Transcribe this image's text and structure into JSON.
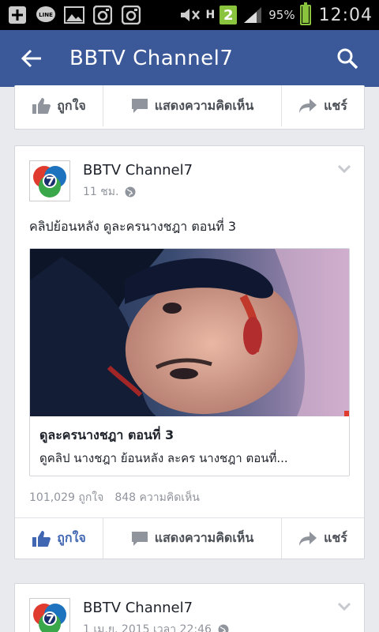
{
  "status_bar": {
    "network": "H",
    "sim_badge": "2",
    "battery_percent_label": "95%",
    "battery_level": 0.95,
    "time": "12:04"
  },
  "app_bar": {
    "title": "BBTV Channel7"
  },
  "top_actions": {
    "like": "ถูกใจ",
    "comment": "แสดงความคิดเห็น",
    "share": "แชร์"
  },
  "post": {
    "page_name": "BBTV Channel7",
    "time": "11 ชม.",
    "text": "คลิปย้อนหลัง ดูละครนางชฎา ตอนที่ 3",
    "link": {
      "title": "ดูละครนางชฎา ตอนที่ 3",
      "description": "ดูคลิป นางชฎา ย้อนหลัง ละคร นางชฎา ตอนที่..."
    },
    "likes": "101,029 ถูกใจ",
    "comments": "848 ความคิดเห็น",
    "actions": {
      "like": "ถูกใจ",
      "comment": "แสดงความคิดเห็น",
      "share": "แชร์"
    }
  },
  "next_post": {
    "page_name": "BBTV Channel7",
    "time": "1 เม.ย. 2015 เวลา 22:46"
  },
  "colors": {
    "facebook_blue": "#3b5998",
    "like_blue": "#4267b2",
    "status_green": "#8ac43f"
  },
  "icons": [
    "plus-icon",
    "line-icon",
    "gallery-icon",
    "instagram-icon",
    "mute-icon",
    "signal-icon",
    "back-arrow-icon",
    "search-icon",
    "thumbs-up-icon",
    "comment-icon",
    "share-icon",
    "globe-icon",
    "chevron-down-icon"
  ]
}
